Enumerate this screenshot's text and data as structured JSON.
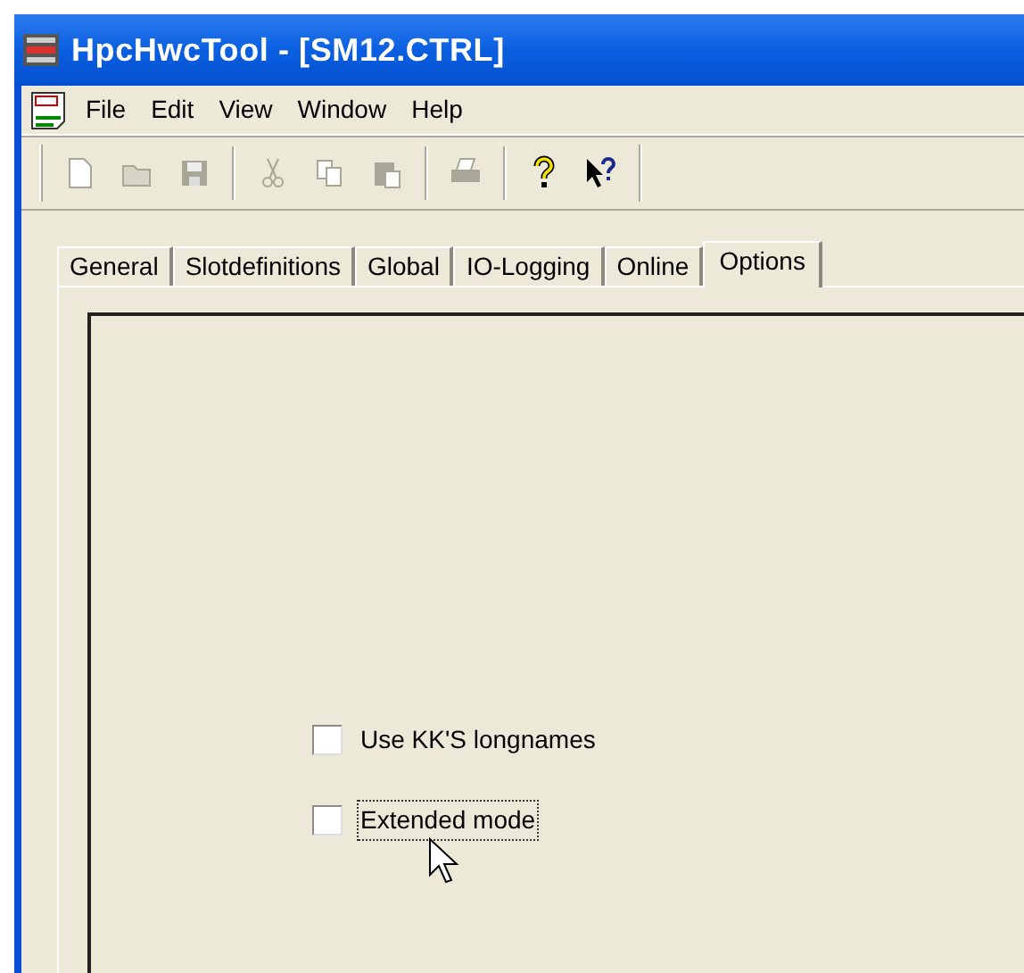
{
  "window": {
    "title": "HpcHwcTool - [SM12.CTRL]"
  },
  "menu": [
    "File",
    "Edit",
    "View",
    "Window",
    "Help"
  ],
  "toolbar": [
    {
      "kind": "new",
      "disabled": true
    },
    {
      "kind": "open",
      "disabled": true
    },
    {
      "kind": "save",
      "disabled": true
    },
    {
      "kind": "sep"
    },
    {
      "kind": "cut",
      "disabled": true
    },
    {
      "kind": "copy",
      "disabled": true
    },
    {
      "kind": "paste",
      "disabled": true
    },
    {
      "kind": "sep"
    },
    {
      "kind": "print",
      "disabled": true
    },
    {
      "kind": "sep"
    },
    {
      "kind": "help",
      "disabled": false
    },
    {
      "kind": "context-help",
      "disabled": false
    }
  ],
  "tabs": [
    {
      "label": "General",
      "selected": false
    },
    {
      "label": "Slotdefinitions",
      "selected": false
    },
    {
      "label": "Global",
      "selected": false
    },
    {
      "label": "IO-Logging",
      "selected": false
    },
    {
      "label": "Online",
      "selected": false
    },
    {
      "label": "Options",
      "selected": true
    }
  ],
  "options": [
    {
      "label": "Use KK'S longnames",
      "checked": false,
      "focused": false
    },
    {
      "label": "Extended mode",
      "checked": false,
      "focused": true
    }
  ]
}
